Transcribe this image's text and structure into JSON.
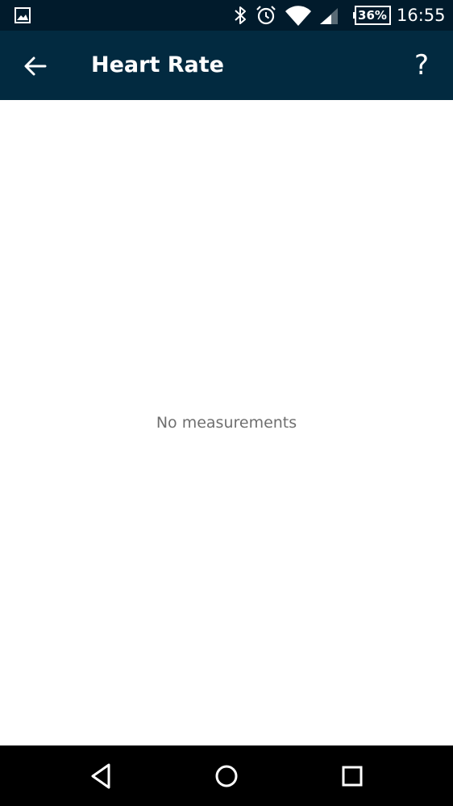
{
  "status_bar": {
    "battery": "36%",
    "time": "16:55",
    "icons": [
      "gallery-icon",
      "bluetooth-icon",
      "alarm-icon",
      "wifi-icon",
      "cell-signal-icon",
      "battery-icon"
    ]
  },
  "app_bar": {
    "title": "Heart Rate",
    "back_icon": "arrow-left-icon",
    "help_label": "?"
  },
  "content": {
    "empty_message": "No measurements"
  },
  "nav_bar": {
    "icons": [
      "nav-back-icon",
      "nav-home-icon",
      "nav-recents-icon"
    ]
  },
  "colors": {
    "status_bar": "#011b2c",
    "app_bar": "#022a40",
    "background": "#ffffff",
    "empty_text": "#6f6f6f",
    "nav_bar": "#000000"
  }
}
